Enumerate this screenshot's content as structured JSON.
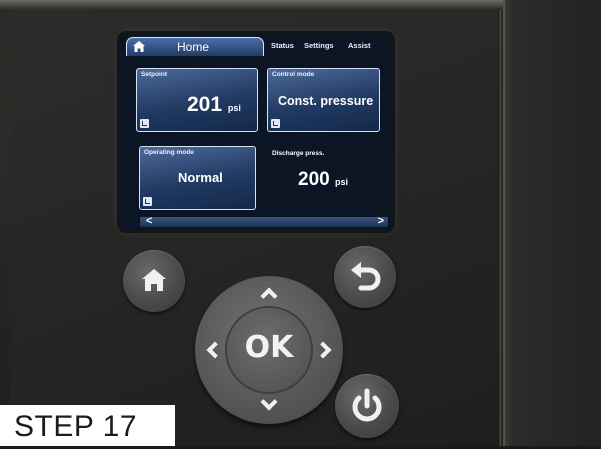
{
  "screen": {
    "tabs": {
      "active": "Home",
      "others": [
        "Status",
        "Settings",
        "Assist"
      ]
    },
    "tiles": {
      "setpoint": {
        "title": "Setpoint",
        "value": "201",
        "unit": "psi"
      },
      "control_mode": {
        "title": "Control mode",
        "value": "Const. pressure"
      },
      "operating_mode": {
        "title": "Operating mode",
        "value": "Normal"
      }
    },
    "discharge": {
      "title": "Discharge press.",
      "value": "200",
      "unit": "psi"
    },
    "scroll": {
      "left": "<",
      "right": ">"
    }
  },
  "keypad": {
    "ok_label": "OK"
  },
  "step": {
    "label": "STEP 17"
  },
  "icons": [
    "home-icon",
    "back-icon",
    "power-icon",
    "arrow-up-icon",
    "arrow-down-icon",
    "arrow-left-icon",
    "arrow-right-icon"
  ],
  "colors": {
    "screen_bg": "#0b1524",
    "tile_accent": "#4d6a99",
    "keypad": "#5a5a58"
  }
}
